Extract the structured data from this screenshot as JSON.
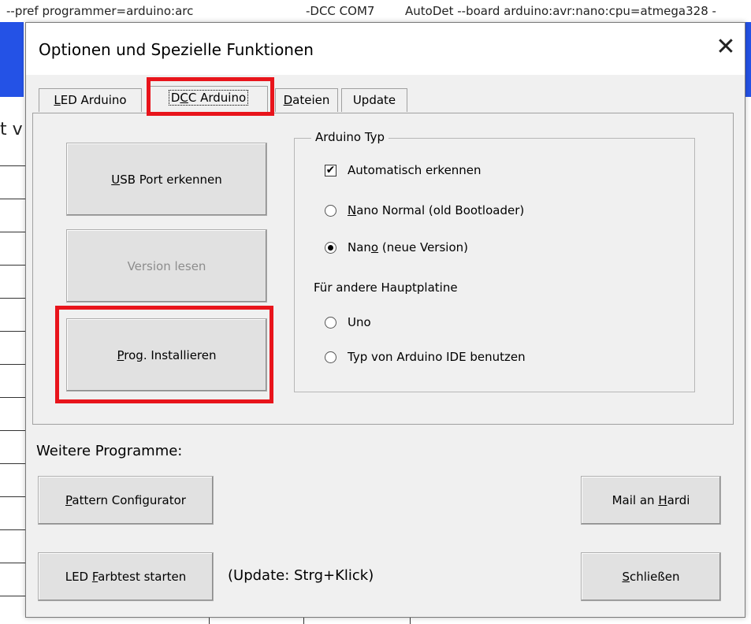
{
  "background": {
    "cmd_left": "--pref programmer=arduino:arc",
    "cmd_mid": "-DCC COM7",
    "cmd_right": "AutoDet --board arduino:avr:nano:cpu=atmega328 -",
    "left_char": "t v"
  },
  "dialog": {
    "title": "Optionen und Spezielle Funktionen",
    "close_symbol": "✕"
  },
  "tabs": [
    {
      "label_pre": "",
      "label_u": "L",
      "label_post": "ED Arduino"
    },
    {
      "label_pre": "D",
      "label_u": "C",
      "label_post": "C Arduino"
    },
    {
      "label_pre": "",
      "label_u": "D",
      "label_post": "ateien"
    },
    {
      "label_pre": "",
      "label_u": "",
      "label_post": "Update"
    }
  ],
  "panel": {
    "usb_pre": "",
    "usb_u": "U",
    "usb_post": "SB Port erkennen",
    "version_label": "Version lesen",
    "prog_pre": "",
    "prog_u": "P",
    "prog_post": "rog. Installieren"
  },
  "arduino_typ": {
    "title": "Arduino Typ",
    "auto_label": "Automatisch erkennen",
    "auto_checked": true,
    "nano_normal_pre": "",
    "nano_normal_u": "N",
    "nano_normal_post": "ano Normal (old Bootloader)",
    "nano_new_pre": "Nan",
    "nano_new_u": "o",
    "nano_new_post": " (neue Version)",
    "other_board_label": "Für andere Hauptplatine",
    "uno_label": "Uno",
    "ide_label": "Typ von Arduino IDE benutzen",
    "selected": "nano_new"
  },
  "footer": {
    "weitere_label": "Weitere Programme:",
    "pattern_pre": "",
    "pattern_u": "P",
    "pattern_post": "attern Configurator",
    "mail_pre": "Mail an ",
    "mail_u": "H",
    "mail_post": "ardi",
    "farbtest_pre": "LED ",
    "farbtest_u": "F",
    "farbtest_post": "arbtest starten",
    "update_hint": "(Update: Strg+Klick)",
    "close_pre": "",
    "close_u": "S",
    "close_post": "chließen"
  },
  "colors": {
    "highlight": "#e8141b",
    "excel_blue": "#2452e6"
  }
}
